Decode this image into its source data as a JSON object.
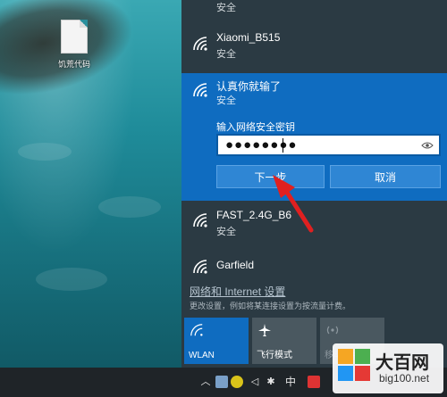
{
  "desktop": {
    "icon_label": "饥荒代码"
  },
  "networks": {
    "top_status": "安全",
    "xiaomi": {
      "name": "Xiaomi_B515",
      "status": "安全"
    },
    "selected": {
      "name": "认真你就输了",
      "status": "安全",
      "key_label": "输入网络安全密钥",
      "password": "●●●●●●●●",
      "next_label": "下一步",
      "cancel_label": "取消"
    },
    "fast": {
      "name": "FAST_2.4G_B6",
      "status": "安全"
    },
    "garfield": {
      "name": "Garfield"
    }
  },
  "settings": {
    "link": "网络和 Internet 设置",
    "description": "更改设置，例如将某连接设置为按流量计费。"
  },
  "quick_actions": {
    "wlan": "WLAN",
    "airplane": "飞行模式",
    "mobile": "移动热点"
  },
  "taskbar": {
    "ime": "中"
  },
  "watermark": {
    "title": "大百网",
    "url": "big100.net"
  },
  "colors": {
    "panel": "#2b3a43",
    "selected": "#0f6cc0",
    "button": "#2f86d4",
    "arrow": "#e02020"
  },
  "icons": [
    "wifi-icon",
    "eye-icon",
    "airplane-icon",
    "hotspot-icon",
    "file-icon"
  ]
}
